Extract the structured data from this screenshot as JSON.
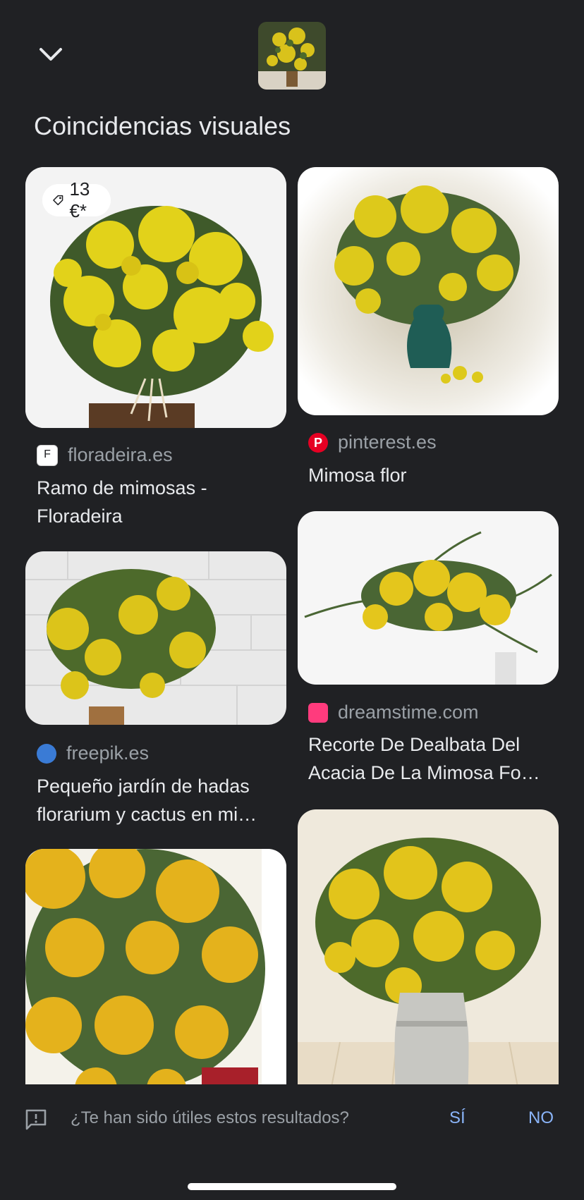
{
  "header": {
    "close_icon": "chevron-down-icon",
    "query_thumbnail": "mimosa-thumbnail"
  },
  "section_title": "Coincidencias visuales",
  "results": [
    {
      "price": "13 €*",
      "source": "floradeira.es",
      "title": "Ramo de mimosas - Floradeira",
      "image": "mimosa bouquet with roots on white background"
    },
    {
      "source": "pinterest.es",
      "title": "Mimosa flor",
      "image": "mimosa in green vase"
    },
    {
      "source": "freepik.es",
      "title": "Pequeño jardín de hadas florarium y cactus en mi…",
      "image": "mimosa branches against white brick wall"
    },
    {
      "source": "dreamstime.com",
      "title": "Recorte De Dealbata Del Acacia De La Mimosa Fo…",
      "image": "mimosa branch on white"
    },
    {
      "image": "dense yellow mimosa close-up"
    },
    {
      "image": "mimosa bouquet in metal milk can"
    }
  ],
  "feedback": {
    "icon": "feedback-icon",
    "question": "¿Te han sido útiles estos resultados?",
    "yes": "SÍ",
    "no": "NO"
  },
  "colors": {
    "background": "#202124",
    "accent": "#8ab4f8",
    "muted": "#9aa0a6"
  }
}
